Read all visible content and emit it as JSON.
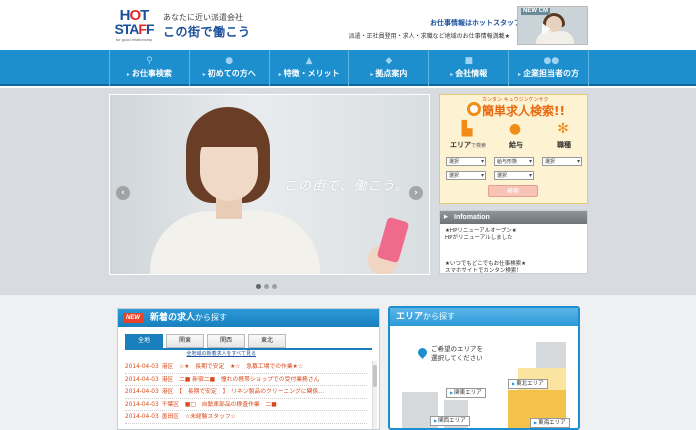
{
  "header": {
    "logo": {
      "line1_a": "H",
      "line1_b": "O",
      "line1_c": "T",
      "line2_a": "STA",
      "line2_b": "F",
      "line2_c": "F",
      "sub": "for good relationship"
    },
    "tagline_small": "あなたに近い派遣会社",
    "tagline_main": "この街で働こう",
    "right_title": "お仕事情報はホットスタッフ",
    "right_sub": "派遣・正社員登用・求人・求職など地域のお仕事情報満載★",
    "cm_label": "NEW CM"
  },
  "nav": {
    "items": [
      {
        "label": "お仕事検索",
        "icon": "search-icon"
      },
      {
        "label": "初めての方へ",
        "icon": "person-icon"
      },
      {
        "label": "特徴・メリット",
        "icon": "thumb-icon"
      },
      {
        "label": "拠点案内",
        "icon": "pin-icon"
      },
      {
        "label": "会社情報",
        "icon": "building-icon"
      },
      {
        "label": "企業担当者の方",
        "icon": "people-icon"
      }
    ]
  },
  "slider": {
    "copy": "この街で、働こう。",
    "prev_label": "‹",
    "next_label": "›"
  },
  "quick_search": {
    "ruby": "カンタン キュウジンケンサク",
    "title": "簡単求人検索!!",
    "columns": [
      {
        "label": "エリア",
        "suffix": "で検索",
        "icon": "area-icon"
      },
      {
        "label": "給与",
        "suffix": "",
        "icon": "money-icon"
      },
      {
        "label": "職種",
        "suffix": "",
        "icon": "gear-icon"
      }
    ],
    "selects": {
      "area1": "選択",
      "area2": "選択",
      "pay_type": "給与形態",
      "pay_amount": "選択",
      "job": "選択"
    },
    "button": "検索"
  },
  "information": {
    "header": "Infomation",
    "lines": [
      "★HPリニューアルオープン★",
      "HPがリニューアルしました",
      "",
      "★いつでもどこでもお仕事検索★",
      "スマホサイトでカンタン検索！"
    ]
  },
  "new_jobs": {
    "badge": "NEW",
    "title": "新着の求人",
    "title_suffix": "から探す",
    "tabs": [
      "全地",
      "関東",
      "関西",
      "東北"
    ],
    "all_link": "全地域の新着求人をすべて見る",
    "rows": [
      {
        "date": "2014-04-03",
        "text": "港区　☆★　長期で安定　★☆　急募工場での作業★☆"
      },
      {
        "date": "2014-04-03",
        "text": "港区　二■ 新宿二■　憧れの携帯ショップでの受付業務さん"
      },
      {
        "date": "2014-04-03",
        "text": "港区　【　長期で安定　】　リネン製品のクリーニングに関係…"
      },
      {
        "date": "2014-04-03",
        "text": "千葉区　■□　自動車部品の検査作業　二■"
      },
      {
        "date": "2014-04-03",
        "text": "墨田区　☆未経験スタッフ☆"
      }
    ]
  },
  "area_search": {
    "title": "エリア",
    "title_suffix": "から探す",
    "message_line1": "ご希望のエリアを",
    "message_line2": "選択してください",
    "labels": [
      "関東エリア",
      "東北エリア",
      "関西エリア",
      "東海エリア"
    ]
  },
  "colors": {
    "nav_blue": "#1d8fcf",
    "brand_blue": "#1a4f9c",
    "brand_red": "#e62828",
    "orange": "#e86a10",
    "job_text": "#d84a1b"
  }
}
